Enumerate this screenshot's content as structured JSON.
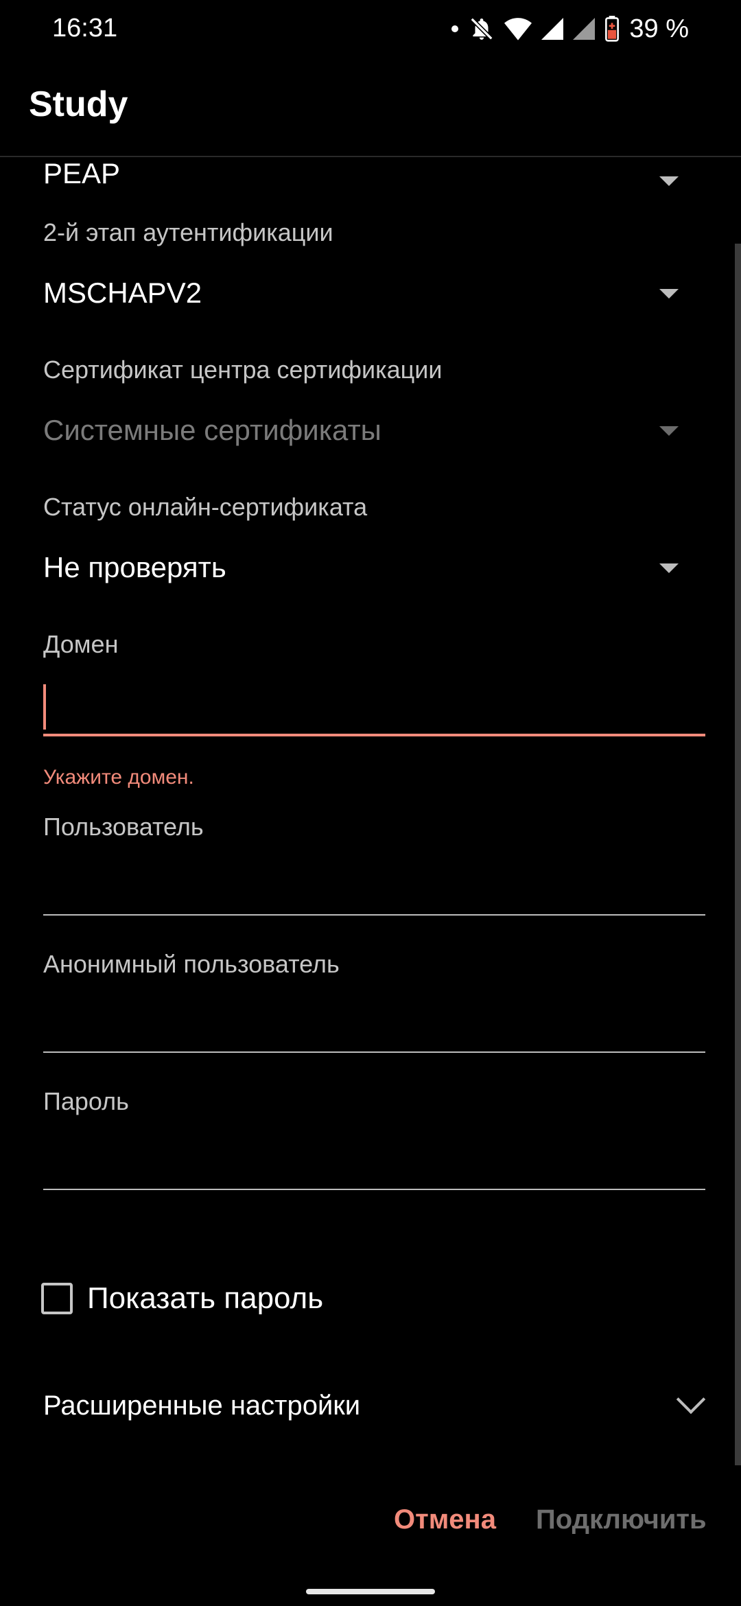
{
  "status_bar": {
    "time": "16:31",
    "battery": "39 %",
    "icons": [
      "dot-icon",
      "bell-off-icon",
      "wifi-icon",
      "signal-icon",
      "signal-icon",
      "battery-saver-icon"
    ]
  },
  "app_bar": {
    "title": "Study"
  },
  "form": {
    "eap_method": {
      "value": "PEAP"
    },
    "phase2": {
      "label": "2-й этап аутентификации",
      "value": "MSCHAPV2"
    },
    "ca_cert": {
      "label": "Сертификат центра сертификации",
      "value": "Системные сертификаты"
    },
    "ocsp": {
      "label": "Статус онлайн-сертификата",
      "value": "Не проверять"
    },
    "domain": {
      "label": "Домен",
      "value": "",
      "error": "Укажите домен."
    },
    "identity": {
      "label": "Пользователь",
      "value": ""
    },
    "anonymous": {
      "label": "Анонимный пользователь",
      "value": ""
    },
    "password": {
      "label": "Пароль",
      "value": ""
    },
    "show_password": {
      "label": "Показать пароль",
      "checked": false
    },
    "advanced": {
      "label": "Расширенные настройки"
    }
  },
  "actions": {
    "cancel": "Отмена",
    "connect": "Подключить"
  },
  "colors": {
    "accent": "#f28b7b",
    "background": "#000000"
  }
}
